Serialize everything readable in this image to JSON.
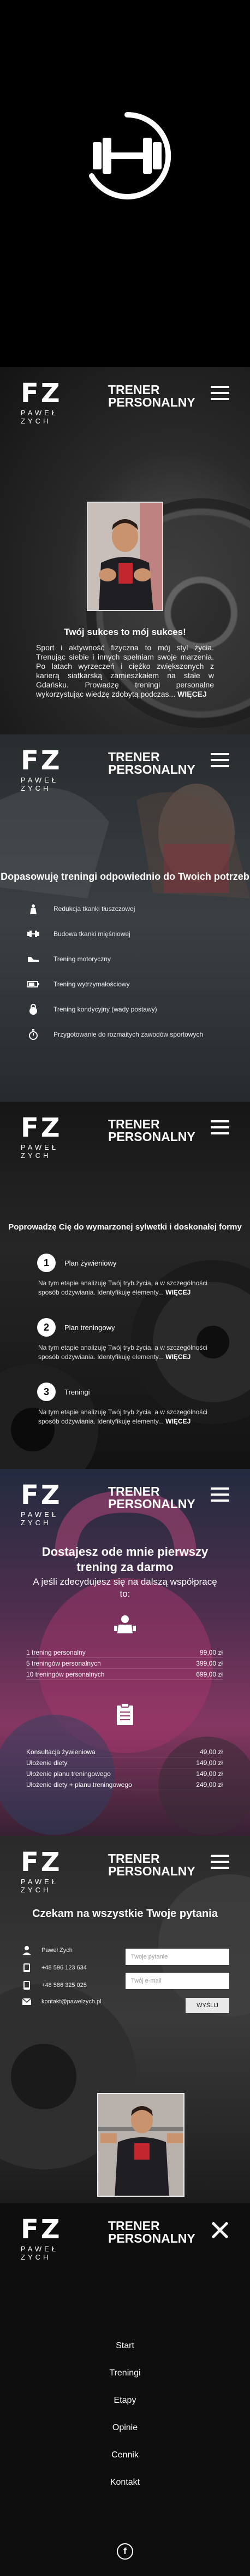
{
  "brand": {
    "logo_mark": "FZ",
    "logo_name": "PAWEŁ ZYCH",
    "title": "TRENER PERSONALNY"
  },
  "hero": {
    "title": "Twój sukces to mój sukces!",
    "text": "Sport i aktywność fizyczna to mój styl życia. Trenując siebie i innych spełniam swoje marzenia. Po latach wyrzeczeń i ciężko zwiększonych z karierą siatkarską zamieszkałem na stałe w Gdańsku. Prowadzę treningi personalne wykorzystując wiedzę zdobytą podczas...",
    "more": "WIĘCEJ"
  },
  "types": {
    "title": "Dopasowuję treningi odpowiednio do Twoich potrzeb",
    "items": [
      {
        "label": "Redukcja tkanki tłuszczowej",
        "icon": "weight-loss-icon"
      },
      {
        "label": "Budowa tkanki mięśniowej",
        "icon": "dumbbell-icon"
      },
      {
        "label": "Trening motoryczny",
        "icon": "shoe-icon"
      },
      {
        "label": "Trening wytrzymałościowy",
        "icon": "battery-icon"
      },
      {
        "label": "Trening kondycyjny (wady postawy)",
        "icon": "kettlebell-icon"
      },
      {
        "label": "Przygotowanie do rozmaitych zawodów sportowych",
        "icon": "stopwatch-icon"
      }
    ]
  },
  "stages": {
    "title": "Poprowadzę Cię do wymarzonej sylwetki i doskonałej formy",
    "items": [
      {
        "num": "1",
        "label": "Plan żywieniowy",
        "text": "Na tym etapie analizuję Twój tryb życia, a w szczególności sposób odżywiania. Identyfikuję elementy... ",
        "more": "WIĘCEJ"
      },
      {
        "num": "2",
        "label": "Plan treningowy",
        "text": "Na tym etapie analizuję Twój tryb życia, a w szczególności sposób odżywiania. Identyfikuję elementy... ",
        "more": "WIĘCEJ"
      },
      {
        "num": "3",
        "label": "Treningi",
        "text": "Na tym etapie analizuję Twój tryb życia, a w szczególności sposób odżywiania. Identyfikuję elementy... ",
        "more": "WIĘCEJ"
      }
    ]
  },
  "pricing": {
    "title": "Dostajesz ode mnie pierwszy trening za darmo",
    "subtitle": "A jeśli zdecydujesz się na dalszą współpracę to:",
    "training_rows": [
      {
        "label": "1 trening personalny",
        "price": "99,00 zł"
      },
      {
        "label": "5 treningów personalnych",
        "price": "399,00 zł"
      },
      {
        "label": "10 treningów personalnych",
        "price": "699,00 zł"
      }
    ],
    "diet_rows": [
      {
        "label": "Konsultacja żywieniowa",
        "price": "49,00 zł"
      },
      {
        "label": "Ułożenie diety",
        "price": "149,00 zł"
      },
      {
        "label": "Ułożenie planu treningowego",
        "price": "149,00 zł"
      },
      {
        "label": "Ułożenie diety + planu treningowego",
        "price": "249,00 zł"
      }
    ]
  },
  "contact": {
    "title": "Czekam na wszystkie Twoje pytania",
    "name": "Paweł Zych",
    "phone1": "+48 596 123 634",
    "phone2": "+48 586 325 025",
    "email": "kontakt@pawelzych.pl",
    "placeholder_name": "Twoje pytanie",
    "placeholder_email": "Twój e-mail",
    "send_label": "WYŚLIJ"
  },
  "menu": {
    "items": [
      "Start",
      "Treningi",
      "Etapy",
      "Opinie",
      "Cennik",
      "Kontakt"
    ],
    "facebook": "f"
  }
}
